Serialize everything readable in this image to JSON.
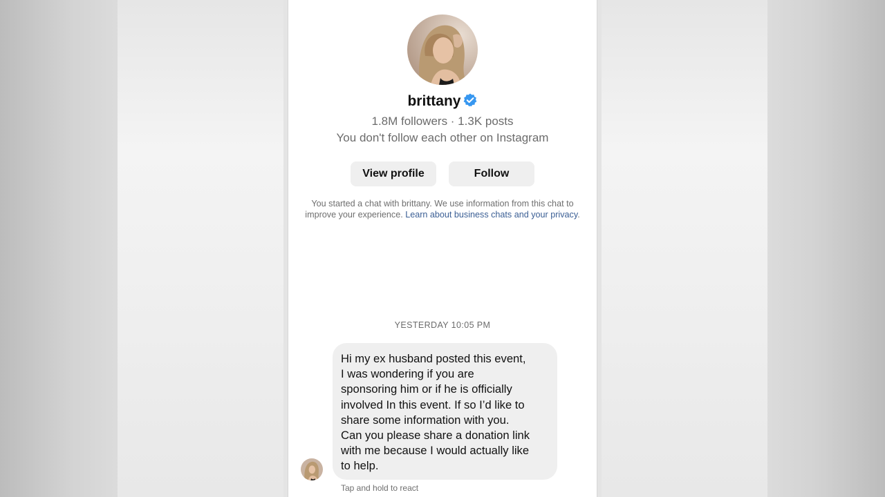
{
  "profile": {
    "username": "brittany",
    "verified_icon": "verified-badge-icon",
    "stats": "1.8M followers · 1.3K posts",
    "relation": "You don't follow each other on Instagram",
    "view_profile_label": "View profile",
    "follow_label": "Follow"
  },
  "disclaimer": {
    "text": "You started a chat with brittany. We use information from this chat to improve your experience. ",
    "link_text": "Learn about business chats and your privacy",
    "suffix": "."
  },
  "chat": {
    "timestamp": "YESTERDAY 10:05 PM",
    "message_lines": [
      "Hi my ex husband posted this event,",
      "I was wondering if you are",
      "sponsoring him or if he is officially",
      "involved In this event. If so I’d like to",
      "share some information with you.",
      "Can you please share a donation link",
      "with me because I would actually like",
      "to help."
    ],
    "react_hint": "Tap and hold to react"
  },
  "colors": {
    "verified": "#3797f0",
    "link": "#3a5e94",
    "bubble": "#efefef",
    "button": "#efefef"
  }
}
